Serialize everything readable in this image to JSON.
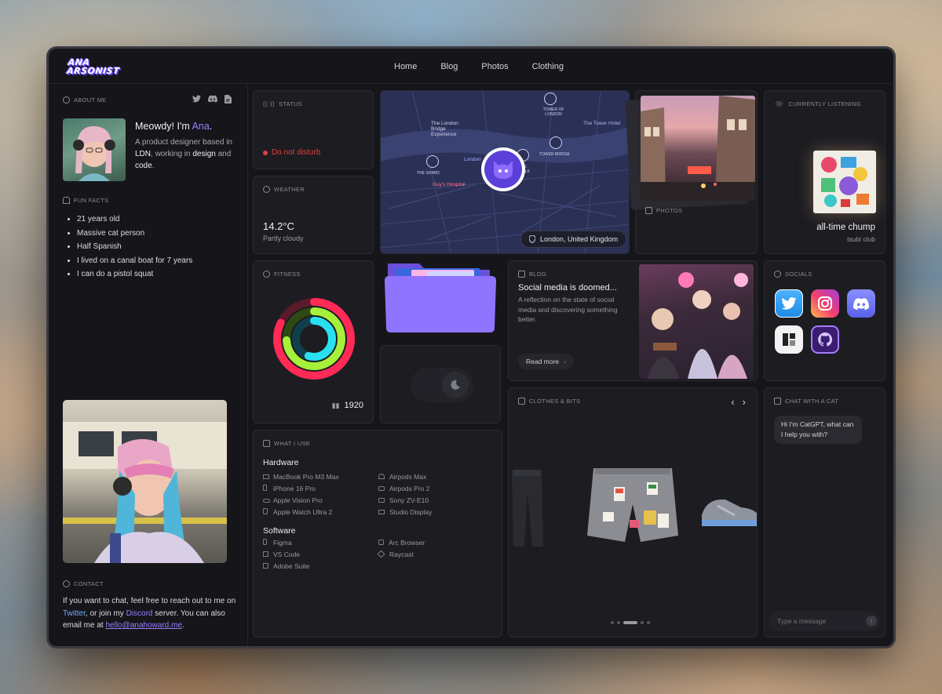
{
  "logo": {
    "line1": "ANA",
    "line2": "ARSONIST"
  },
  "nav": [
    "Home",
    "Blog",
    "Photos",
    "Clothing"
  ],
  "about": {
    "label": "About me",
    "greeting": "Meowdy! I'm ",
    "name": "Ana",
    "greeting_end": ".",
    "bio_1": "A product designer based in ",
    "bio_ldn": "LDN",
    "bio_2": ", working in ",
    "bio_design": "design",
    "bio_3": " and ",
    "bio_code": "code",
    "bio_4": "."
  },
  "fun_facts": {
    "label": "Fun facts",
    "items": [
      "21 years old",
      "Massive cat person",
      "Half Spanish",
      "I lived on a canal boat for 7 years",
      "I can do a pistol squat"
    ]
  },
  "contact": {
    "label": "Contact",
    "t1": "If you want to chat, feel free to reach out to me on ",
    "twitter": "Twitter",
    "t2": ", or join my ",
    "discord": "Discord",
    "t3": " server. You can also email me at ",
    "email": "hello@anahoward.me",
    "t4": "."
  },
  "status": {
    "label": "Status",
    "value": "Do not disturb",
    "color": "#e0433f"
  },
  "weather": {
    "label": "Weather",
    "temp": "14.2°C",
    "desc": "Partly cloudy"
  },
  "map": {
    "location": "London, United Kingdom",
    "places": [
      "TOWER OF LONDON",
      "The London Bridge Experience",
      "The Tower Hotel",
      "THE SHARD",
      "TOWER BRIDGE",
      "Guy's Hospital",
      "London",
      "THE WALK"
    ]
  },
  "photos": {
    "label": "Photos"
  },
  "listening": {
    "label": "Currently listening",
    "title": "all-time chump",
    "artist": "tsubi club"
  },
  "fitness": {
    "label": "Fitness",
    "steps": "1920",
    "rings": [
      0.82,
      0.74,
      0.55
    ]
  },
  "blog": {
    "label": "Blog",
    "title": "Social media is doomed...",
    "desc": "A reflection on the state of social media and discovering something better.",
    "cta": "Read more"
  },
  "socials": {
    "label": "Socials",
    "items": [
      "twitter-icon",
      "instagram-icon",
      "discord-icon",
      "layers-icon",
      "github-icon"
    ]
  },
  "tools": {
    "label": "What I use",
    "hardware_title": "Hardware",
    "hardware": [
      "MacBook Pro M3 Max",
      "iPhone 16 Pro",
      "Apple Vision Pro",
      "Apple Watch Ultra 2",
      "Airpods Max",
      "Airpods Pro 2",
      "Sony ZV-E10",
      "Studio Display"
    ],
    "software_title": "Software",
    "software": [
      "Figma",
      "VS Code",
      "Adobe Suite",
      "Arc Browser",
      "Raycast"
    ]
  },
  "clothes": {
    "label": "Clothes & bits"
  },
  "chat": {
    "label": "Chat with a cat",
    "message": "Hi I'm CatGPT, what can I help you with?",
    "placeholder": "Type a message"
  },
  "colors": {
    "accent": "#9a7dff",
    "link": "#6fa8ff",
    "bg": "#16161a",
    "card": "#1c1c21"
  }
}
